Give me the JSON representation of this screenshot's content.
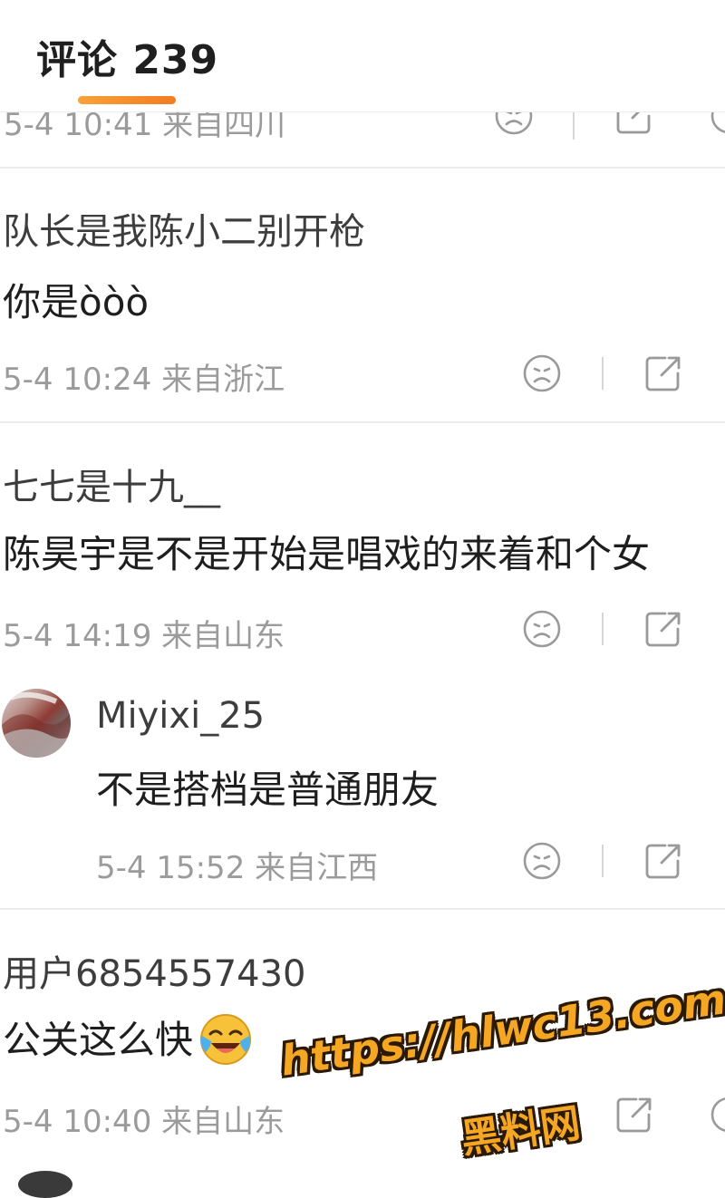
{
  "header": {
    "title": "评论 239",
    "accent_color": "#f47b20"
  },
  "cut_row": {
    "meta": "5-4 10:41 来自四川"
  },
  "comments": [
    {
      "user": "队长是我陈小二别开枪",
      "text": "你是òòò",
      "meta": "5-4 10:24 来自浙江"
    },
    {
      "user": "七七是十九__",
      "text": "陈昊宇是不是开始是唱戏的来着和个女",
      "meta": "5-4 14:19 来自山东"
    },
    {
      "user": "用户6854557430",
      "text": "公关这么快",
      "meta": "5-4 10:40 来自山东"
    }
  ],
  "reply": {
    "user": "Miyixi_25",
    "text": "不是搭档是普通朋友",
    "meta": "5-4 15:52 来自江西"
  },
  "icons": {
    "dislike": "sad-face-icon",
    "share": "share-icon",
    "emoji": "laughing-crying-emoji"
  },
  "watermark": {
    "url": "https://hlwc13.com",
    "site": "黑料网",
    "color": "#f5a623"
  }
}
